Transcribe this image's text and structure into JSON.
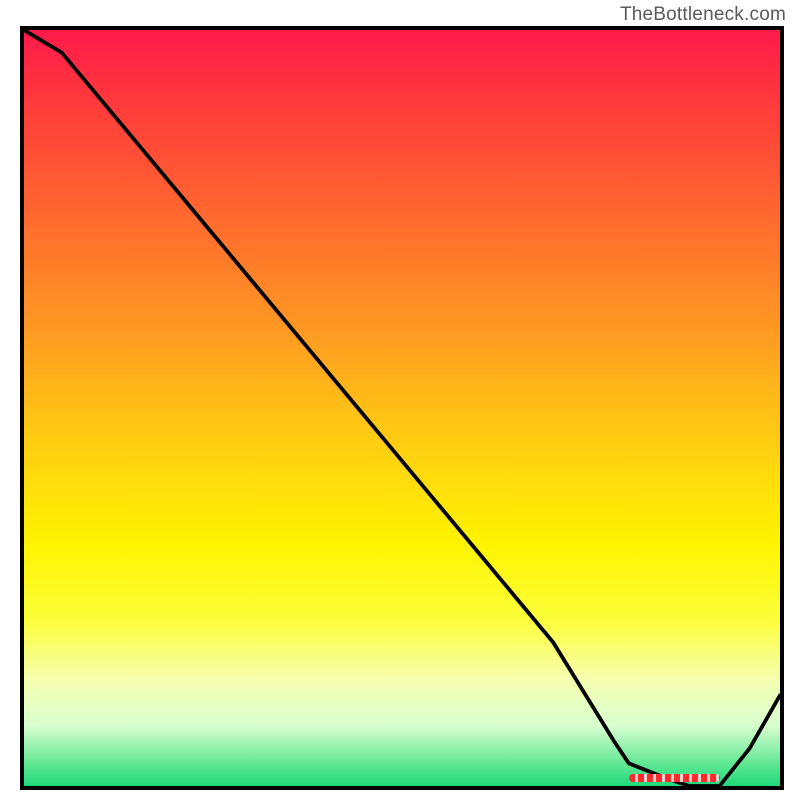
{
  "attribution_text": "TheBottleneck.com",
  "gradient_colors": {
    "top": "#ff1a4a",
    "mid_upper": "#ff9a22",
    "mid_lower": "#fff400",
    "bottom": "#1ed97a"
  },
  "chart_data": {
    "type": "line",
    "title": "",
    "xlabel": "",
    "ylabel": "",
    "xlim": [
      0,
      100
    ],
    "ylim": [
      0,
      100
    ],
    "grid": false,
    "legend_position": "none",
    "series": [
      {
        "name": "bottleneck-curve",
        "x": [
          0,
          5,
          20,
          25,
          30,
          40,
          50,
          60,
          70,
          78,
          80,
          85,
          88,
          92,
          96,
          100
        ],
        "values": [
          100,
          97,
          79,
          73,
          67,
          55,
          43,
          31,
          19,
          6,
          3,
          1,
          0,
          0,
          5,
          12
        ]
      }
    ],
    "annotations": [
      {
        "name": "optimal-range",
        "x_start": 80,
        "x_end": 92,
        "y": 0
      }
    ]
  }
}
